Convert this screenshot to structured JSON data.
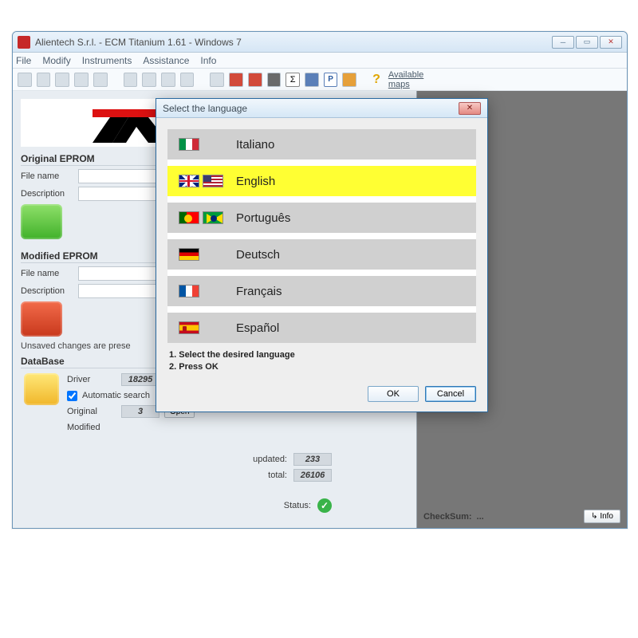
{
  "window": {
    "title": "Alientech S.r.l.  - ECM Titanium 1.61 - Windows 7"
  },
  "menu": [
    "File",
    "Modify",
    "Instruments",
    "Assistance",
    "Info"
  ],
  "toolbar_right_label": "Available maps",
  "groups": {
    "original": {
      "title": "Original EPROM",
      "filename_label": "File name",
      "desc_label": "Description",
      "filename": "",
      "desc": ""
    },
    "modified": {
      "title": "Modified EPROM",
      "filename_label": "File name",
      "desc_label": "Description",
      "filename": "",
      "desc": ""
    }
  },
  "status_line": "Unsaved changes are prese",
  "database": {
    "title": "DataBase",
    "driver_label": "Driver",
    "driver_count": "18295",
    "open_label": "Open",
    "auto_label": "Automatic search",
    "auto_checked": true,
    "original_label": "Original",
    "original_count": "3",
    "modified_label": "Modified",
    "updated_label": "updated:",
    "updated_count": "233",
    "total_label": "total:",
    "total_count": "26106",
    "status_label": "Status:"
  },
  "checksum": {
    "label": "CheckSum:",
    "value": "...",
    "info_label": "Info"
  },
  "dialog": {
    "title": "Select the language",
    "languages": [
      {
        "name": "Italiano",
        "flags": [
          "it"
        ],
        "selected": false
      },
      {
        "name": "English",
        "flags": [
          "uk",
          "us"
        ],
        "selected": true
      },
      {
        "name": "Português",
        "flags": [
          "pt",
          "br"
        ],
        "selected": false
      },
      {
        "name": "Deutsch",
        "flags": [
          "de"
        ],
        "selected": false
      },
      {
        "name": "Français",
        "flags": [
          "fr"
        ],
        "selected": false
      },
      {
        "name": "Español",
        "flags": [
          "es"
        ],
        "selected": false
      }
    ],
    "instr1": "1. Select the desired language",
    "instr2": "2. Press OK",
    "ok_label": "OK",
    "cancel_label": "Cancel"
  }
}
